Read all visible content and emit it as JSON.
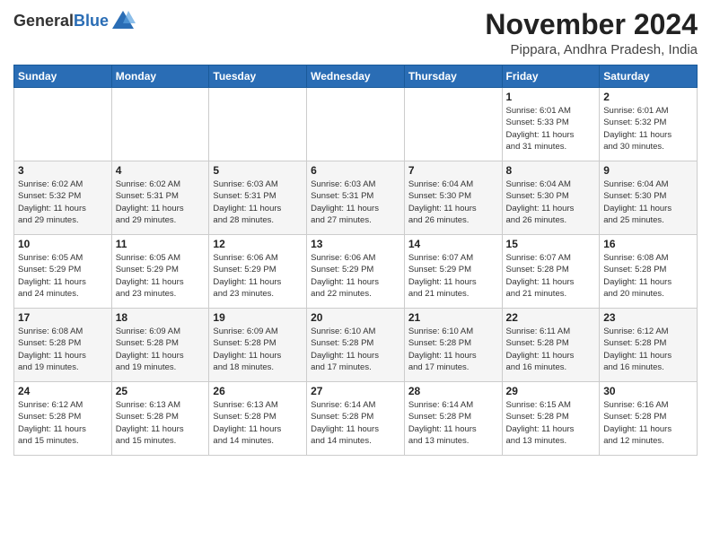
{
  "header": {
    "logo_general": "General",
    "logo_blue": "Blue",
    "month_year": "November 2024",
    "location": "Pippara, Andhra Pradesh, India"
  },
  "calendar": {
    "weekdays": [
      "Sunday",
      "Monday",
      "Tuesday",
      "Wednesday",
      "Thursday",
      "Friday",
      "Saturday"
    ],
    "weeks": [
      [
        {
          "day": "",
          "info": ""
        },
        {
          "day": "",
          "info": ""
        },
        {
          "day": "",
          "info": ""
        },
        {
          "day": "",
          "info": ""
        },
        {
          "day": "",
          "info": ""
        },
        {
          "day": "1",
          "info": "Sunrise: 6:01 AM\nSunset: 5:33 PM\nDaylight: 11 hours\nand 31 minutes."
        },
        {
          "day": "2",
          "info": "Sunrise: 6:01 AM\nSunset: 5:32 PM\nDaylight: 11 hours\nand 30 minutes."
        }
      ],
      [
        {
          "day": "3",
          "info": "Sunrise: 6:02 AM\nSunset: 5:32 PM\nDaylight: 11 hours\nand 29 minutes."
        },
        {
          "day": "4",
          "info": "Sunrise: 6:02 AM\nSunset: 5:31 PM\nDaylight: 11 hours\nand 29 minutes."
        },
        {
          "day": "5",
          "info": "Sunrise: 6:03 AM\nSunset: 5:31 PM\nDaylight: 11 hours\nand 28 minutes."
        },
        {
          "day": "6",
          "info": "Sunrise: 6:03 AM\nSunset: 5:31 PM\nDaylight: 11 hours\nand 27 minutes."
        },
        {
          "day": "7",
          "info": "Sunrise: 6:04 AM\nSunset: 5:30 PM\nDaylight: 11 hours\nand 26 minutes."
        },
        {
          "day": "8",
          "info": "Sunrise: 6:04 AM\nSunset: 5:30 PM\nDaylight: 11 hours\nand 26 minutes."
        },
        {
          "day": "9",
          "info": "Sunrise: 6:04 AM\nSunset: 5:30 PM\nDaylight: 11 hours\nand 25 minutes."
        }
      ],
      [
        {
          "day": "10",
          "info": "Sunrise: 6:05 AM\nSunset: 5:29 PM\nDaylight: 11 hours\nand 24 minutes."
        },
        {
          "day": "11",
          "info": "Sunrise: 6:05 AM\nSunset: 5:29 PM\nDaylight: 11 hours\nand 23 minutes."
        },
        {
          "day": "12",
          "info": "Sunrise: 6:06 AM\nSunset: 5:29 PM\nDaylight: 11 hours\nand 23 minutes."
        },
        {
          "day": "13",
          "info": "Sunrise: 6:06 AM\nSunset: 5:29 PM\nDaylight: 11 hours\nand 22 minutes."
        },
        {
          "day": "14",
          "info": "Sunrise: 6:07 AM\nSunset: 5:29 PM\nDaylight: 11 hours\nand 21 minutes."
        },
        {
          "day": "15",
          "info": "Sunrise: 6:07 AM\nSunset: 5:28 PM\nDaylight: 11 hours\nand 21 minutes."
        },
        {
          "day": "16",
          "info": "Sunrise: 6:08 AM\nSunset: 5:28 PM\nDaylight: 11 hours\nand 20 minutes."
        }
      ],
      [
        {
          "day": "17",
          "info": "Sunrise: 6:08 AM\nSunset: 5:28 PM\nDaylight: 11 hours\nand 19 minutes."
        },
        {
          "day": "18",
          "info": "Sunrise: 6:09 AM\nSunset: 5:28 PM\nDaylight: 11 hours\nand 19 minutes."
        },
        {
          "day": "19",
          "info": "Sunrise: 6:09 AM\nSunset: 5:28 PM\nDaylight: 11 hours\nand 18 minutes."
        },
        {
          "day": "20",
          "info": "Sunrise: 6:10 AM\nSunset: 5:28 PM\nDaylight: 11 hours\nand 17 minutes."
        },
        {
          "day": "21",
          "info": "Sunrise: 6:10 AM\nSunset: 5:28 PM\nDaylight: 11 hours\nand 17 minutes."
        },
        {
          "day": "22",
          "info": "Sunrise: 6:11 AM\nSunset: 5:28 PM\nDaylight: 11 hours\nand 16 minutes."
        },
        {
          "day": "23",
          "info": "Sunrise: 6:12 AM\nSunset: 5:28 PM\nDaylight: 11 hours\nand 16 minutes."
        }
      ],
      [
        {
          "day": "24",
          "info": "Sunrise: 6:12 AM\nSunset: 5:28 PM\nDaylight: 11 hours\nand 15 minutes."
        },
        {
          "day": "25",
          "info": "Sunrise: 6:13 AM\nSunset: 5:28 PM\nDaylight: 11 hours\nand 15 minutes."
        },
        {
          "day": "26",
          "info": "Sunrise: 6:13 AM\nSunset: 5:28 PM\nDaylight: 11 hours\nand 14 minutes."
        },
        {
          "day": "27",
          "info": "Sunrise: 6:14 AM\nSunset: 5:28 PM\nDaylight: 11 hours\nand 14 minutes."
        },
        {
          "day": "28",
          "info": "Sunrise: 6:14 AM\nSunset: 5:28 PM\nDaylight: 11 hours\nand 13 minutes."
        },
        {
          "day": "29",
          "info": "Sunrise: 6:15 AM\nSunset: 5:28 PM\nDaylight: 11 hours\nand 13 minutes."
        },
        {
          "day": "30",
          "info": "Sunrise: 6:16 AM\nSunset: 5:28 PM\nDaylight: 11 hours\nand 12 minutes."
        }
      ]
    ]
  }
}
